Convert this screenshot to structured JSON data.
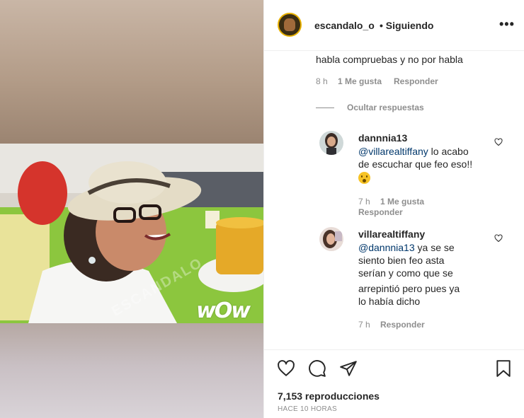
{
  "post": {
    "username": "escandalo_o",
    "follow_status": "• Siguiendo",
    "more_label": "•••",
    "overlay_brand": "wOw",
    "watermark": "ESCANDALO"
  },
  "comments": {
    "prev_tail_text": "habla compruebas y no por habla",
    "prev_meta": {
      "time": "8 h",
      "likes": "1 Me gusta",
      "reply": "Responder"
    },
    "hide_replies": "Ocultar respuestas",
    "replies": [
      {
        "user": "dannnia13",
        "mention": "@villarealtiffany",
        "text_line1": " lo acabo",
        "text_line2": "de escuchar que feo eso!!",
        "time": "7 h",
        "likes": "1 Me gusta",
        "reply": "Responder"
      },
      {
        "user": "villarealtiffany",
        "mention": "@dannnia13",
        "text_line1": " ya se se",
        "text_line2": "siento bien feo asta",
        "text_line3": "serían y como que se",
        "text_line4": "arrepintió pero pues ya",
        "text_line5": "lo había dicho",
        "time": "7 h",
        "reply": "Responder"
      }
    ]
  },
  "footer": {
    "views": "7,153 reproducciones",
    "time_ago": "HACE 10 HORAS"
  },
  "icons": [
    "heart-icon",
    "comment-icon",
    "share-icon",
    "bookmark-icon",
    "more-options-icon"
  ],
  "colors": {
    "link": "#00376b",
    "meta": "#8e8e8e",
    "text": "#262626"
  }
}
